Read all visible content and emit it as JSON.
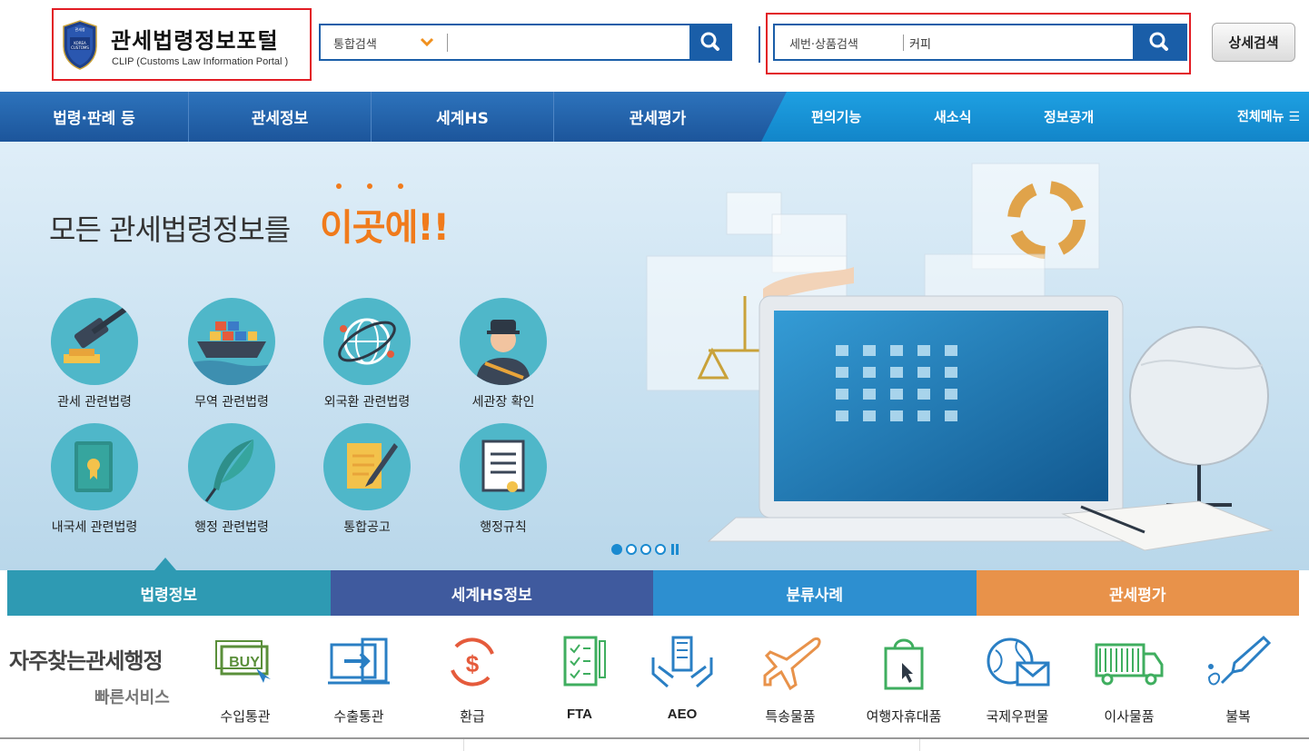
{
  "header": {
    "logo_title": "관세법령정보포털",
    "logo_subtitle": "CLIP (Customs Law Information Portal )",
    "search1": {
      "category": "통합검색",
      "value": ""
    },
    "search2": {
      "category": "세번·상품검색",
      "value": "커피"
    },
    "detail_search_label": "상세검색"
  },
  "nav": {
    "main": [
      "법령·판례 등",
      "관세정보",
      "세계HS",
      "관세평가"
    ],
    "sub": [
      "편의기능",
      "새소식",
      "정보공개"
    ],
    "all_menu": "전체메뉴"
  },
  "hero": {
    "title": "모든 관세법령정보를",
    "accent": "이곳에!!",
    "services": [
      {
        "label": "관세 관련법령",
        "icon": "gavel-icon"
      },
      {
        "label": "무역 관련법령",
        "icon": "cargo-ship-icon"
      },
      {
        "label": "외국환 관련법령",
        "icon": "globe-exchange-icon"
      },
      {
        "label": "세관장 확인",
        "icon": "customs-officer-icon"
      },
      {
        "label": "내국세 관련법령",
        "icon": "tax-book-icon"
      },
      {
        "label": "행정 관련법령",
        "icon": "quill-icon"
      },
      {
        "label": "통합공고",
        "icon": "notice-document-icon"
      },
      {
        "label": "행정규칙",
        "icon": "rule-certificate-icon"
      }
    ],
    "carousel": {
      "slides": 4,
      "active": 1
    }
  },
  "category_tabs": [
    {
      "label": "법령정보",
      "color": "#2e9ab3"
    },
    {
      "label": "세계HS정보",
      "color": "#3f5a9e"
    },
    {
      "label": "분류사례",
      "color": "#2d8fd0"
    },
    {
      "label": "관세평가",
      "color": "#e8924a"
    }
  ],
  "quick": {
    "title": "자주찾는관세행정",
    "subtitle": "빠른서비스",
    "items": [
      {
        "label": "수입통관",
        "icon": "buy-icon"
      },
      {
        "label": "수출통관",
        "icon": "export-icon"
      },
      {
        "label": "환급",
        "icon": "refund-icon"
      },
      {
        "label": "FTA",
        "icon": "checklist-icon"
      },
      {
        "label": "AEO",
        "icon": "building-hands-icon"
      },
      {
        "label": "특송물품",
        "icon": "airplane-icon"
      },
      {
        "label": "여행자휴대품",
        "icon": "shopping-bag-icon"
      },
      {
        "label": "국제우편물",
        "icon": "global-mail-icon"
      },
      {
        "label": "이사물품",
        "icon": "truck-icon"
      },
      {
        "label": "불복",
        "icon": "pen-nib-icon"
      }
    ]
  }
}
